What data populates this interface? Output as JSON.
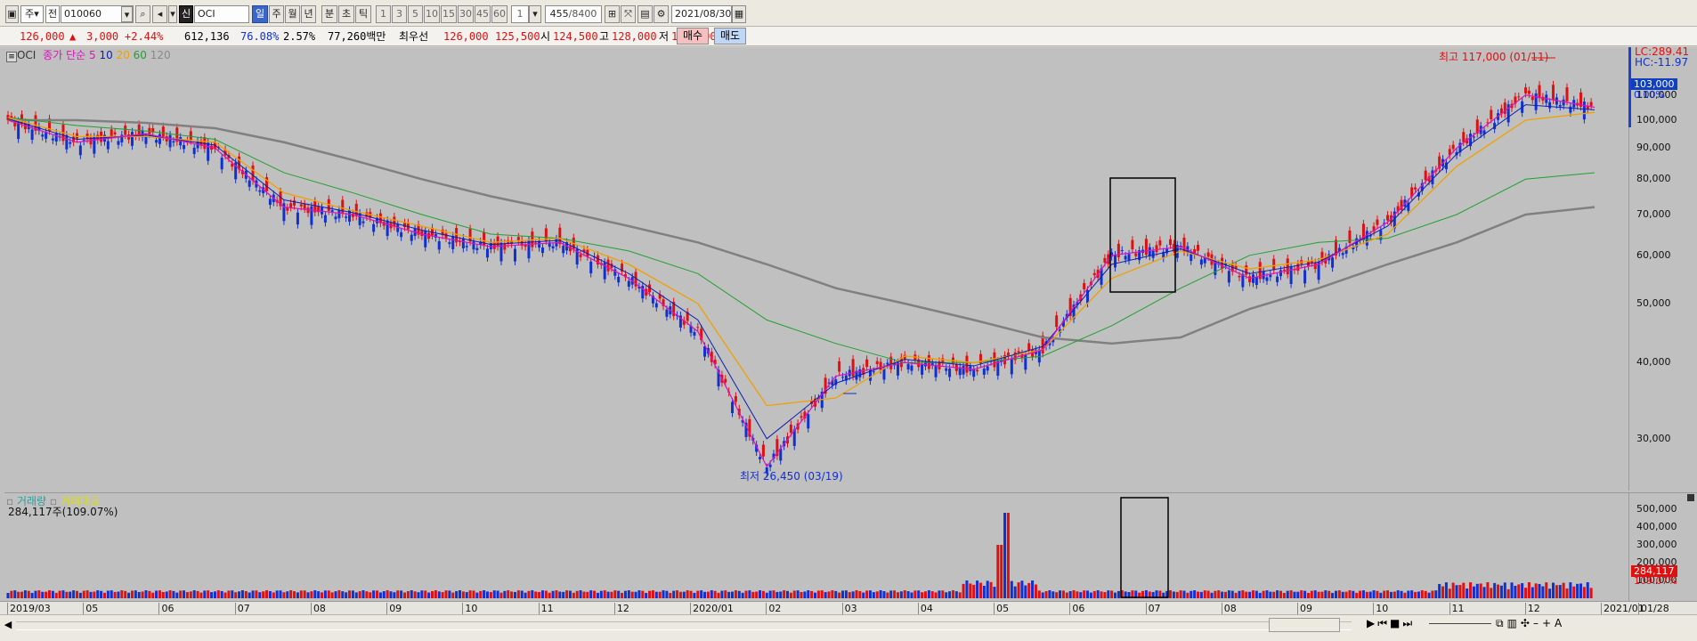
{
  "toolbar": {
    "period_short": "주",
    "all_label": "전",
    "code": "010060",
    "name": "OCI",
    "credit_label": "신",
    "periods": [
      "일",
      "주",
      "월",
      "년",
      "분",
      "초",
      "틱"
    ],
    "active_period": "일",
    "intervals": [
      "1",
      "3",
      "5",
      "10",
      "15",
      "30",
      "45",
      "60"
    ],
    "interval_count": "1",
    "count_value": "455",
    "count_total": "/8400",
    "date": "2021/08/30"
  },
  "quote": {
    "price": "126,000",
    "change_arrow": "▲",
    "change": "3,000",
    "change_rate": "+2.44%",
    "volume": "612,136",
    "vol_ratio": "76.08%",
    "turnover_rate": "2.57%",
    "amount": "77,260백만",
    "best_label": "최우선",
    "best_ask": "126,000",
    "best_bid": "125,500",
    "open_label": "시",
    "open": "124,500",
    "high_label": "고",
    "high": "128,000",
    "low_label": "저",
    "low": "124,000",
    "buy_label": "매수",
    "sell_label": "매도"
  },
  "legend": {
    "name": "OCI",
    "price_label": "종가 단순",
    "ma_labels": [
      "5",
      "10",
      "20",
      "60",
      "120"
    ],
    "volume_label": "거래량",
    "amount_label": "거래대금",
    "volume_value": "284,117주(109.07%)"
  },
  "annotations": {
    "high": "최고 117,000 (01/11)",
    "low": "최저 26,450 (03/19)"
  },
  "price_axis": {
    "lc": "LC:289.41",
    "hc": "HC:-11.97",
    "current": "103,000",
    "pct": "0.00%",
    "ticks": [
      "110,000",
      "100,000",
      "90,000",
      "80,000",
      "70,000",
      "60,000",
      "50,000",
      "40,000",
      "30,000"
    ]
  },
  "volume_axis": {
    "ticks": [
      "500,000",
      "400,000",
      "300,000",
      "200,000",
      "100,000"
    ],
    "current": "284,117",
    "pct": "109.07%"
  },
  "date_axis": [
    "2019/03",
    "05",
    "06",
    "07",
    "08",
    "09",
    "10",
    "11",
    "12",
    "2020/01",
    "02",
    "03",
    "04",
    "05",
    "06",
    "07",
    "08",
    "09",
    "10",
    "11",
    "12",
    "2021/01",
    "01/28"
  ],
  "colors": {
    "up": "#e01010",
    "down": "#1030d0",
    "ma5": "#e010c0",
    "ma10": "#1020b0",
    "ma20": "#f0a000",
    "ma60": "#20a030",
    "ma120": "#808080",
    "background": "#c0c0c0"
  },
  "chart_data": {
    "type": "line",
    "series": [
      {
        "name": "5",
        "values": [
          100000,
          92000,
          95000,
          90000,
          72000,
          70000,
          65000,
          62000,
          63000,
          55000,
          45000,
          27000,
          38000,
          40000,
          39000,
          42000,
          60000,
          62000,
          55000,
          58000,
          68000,
          90000,
          110000,
          105000
        ]
      },
      {
        "name": "10",
        "values": [
          100500,
          93000,
          94500,
          91000,
          74000,
          70500,
          66000,
          62500,
          63500,
          56000,
          47000,
          30000,
          37000,
          40500,
          39500,
          42500,
          58000,
          61500,
          56000,
          58500,
          67000,
          88000,
          106000,
          104000
        ]
      },
      {
        "name": "20",
        "values": [
          101000,
          94000,
          94000,
          92000,
          76000,
          71000,
          67000,
          63000,
          64000,
          58000,
          50000,
          34000,
          35000,
          41000,
          40000,
          42000,
          55000,
          61000,
          57000,
          59000,
          65000,
          84000,
          100000,
          103000
        ]
      },
      {
        "name": "60",
        "values": [
          101000,
          98000,
          96000,
          93000,
          82000,
          76000,
          70000,
          65000,
          64000,
          61000,
          56000,
          47000,
          43000,
          40000,
          40000,
          41000,
          46000,
          53000,
          60000,
          63000,
          64000,
          70000,
          80000,
          82000
        ]
      },
      {
        "name": "120",
        "values": [
          100000,
          100000,
          99000,
          97000,
          92000,
          86000,
          80000,
          75000,
          71000,
          67000,
          63000,
          58000,
          53000,
          50000,
          47000,
          44000,
          43000,
          44000,
          49000,
          53000,
          58000,
          63000,
          70000,
          72000
        ]
      }
    ],
    "xlabel": "",
    "ylabel": "",
    "ylim": [
      25000,
      130000
    ],
    "log_scale": true
  }
}
